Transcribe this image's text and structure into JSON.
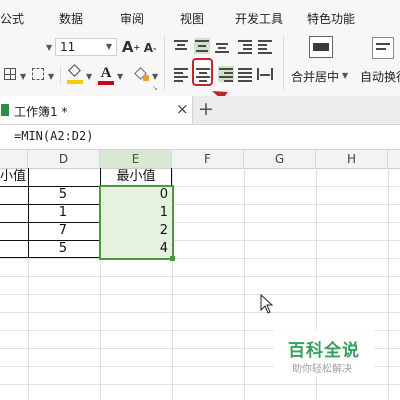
{
  "menu": {
    "items": [
      "公式",
      "数据",
      "审阅",
      "视图",
      "开发工具",
      "特色功能"
    ]
  },
  "ribbon": {
    "font_size": "11",
    "grow_font_glyph": "A",
    "shrink_font_glyph": "A",
    "font_color_glyph": "A",
    "merge_center_label": "合并居中",
    "auto_wrap_label": "自动换行",
    "accent_color": "#c0252c",
    "icons": [
      "align-top-icon",
      "align-middle-icon",
      "align-bottom-icon",
      "indent-decrease-icon",
      "indent-increase-icon",
      "align-left-icon",
      "align-center-icon",
      "align-right-icon",
      "justify-icon",
      "distributed-icon",
      "merge-center-icon",
      "wrap-text-icon",
      "borders-icon",
      "cell-style-icon",
      "fill-color-icon",
      "font-color-icon",
      "clear-format-icon"
    ]
  },
  "tabbar": {
    "doc_title": "工作簿1 *",
    "close_glyph": "×",
    "add_glyph": "+"
  },
  "formula": {
    "text": "=MIN(A2:D2)"
  },
  "columns": [
    "D",
    "E",
    "F",
    "G",
    "H"
  ],
  "sheet": {
    "header_c": "小值",
    "header_e": "最小值",
    "d_values": [
      "5",
      "1",
      "7",
      "5"
    ],
    "e_values": [
      "0",
      "1",
      "2",
      "4"
    ]
  },
  "watermark": {
    "title": "百科全说",
    "subtitle": "助你轻松解决"
  }
}
